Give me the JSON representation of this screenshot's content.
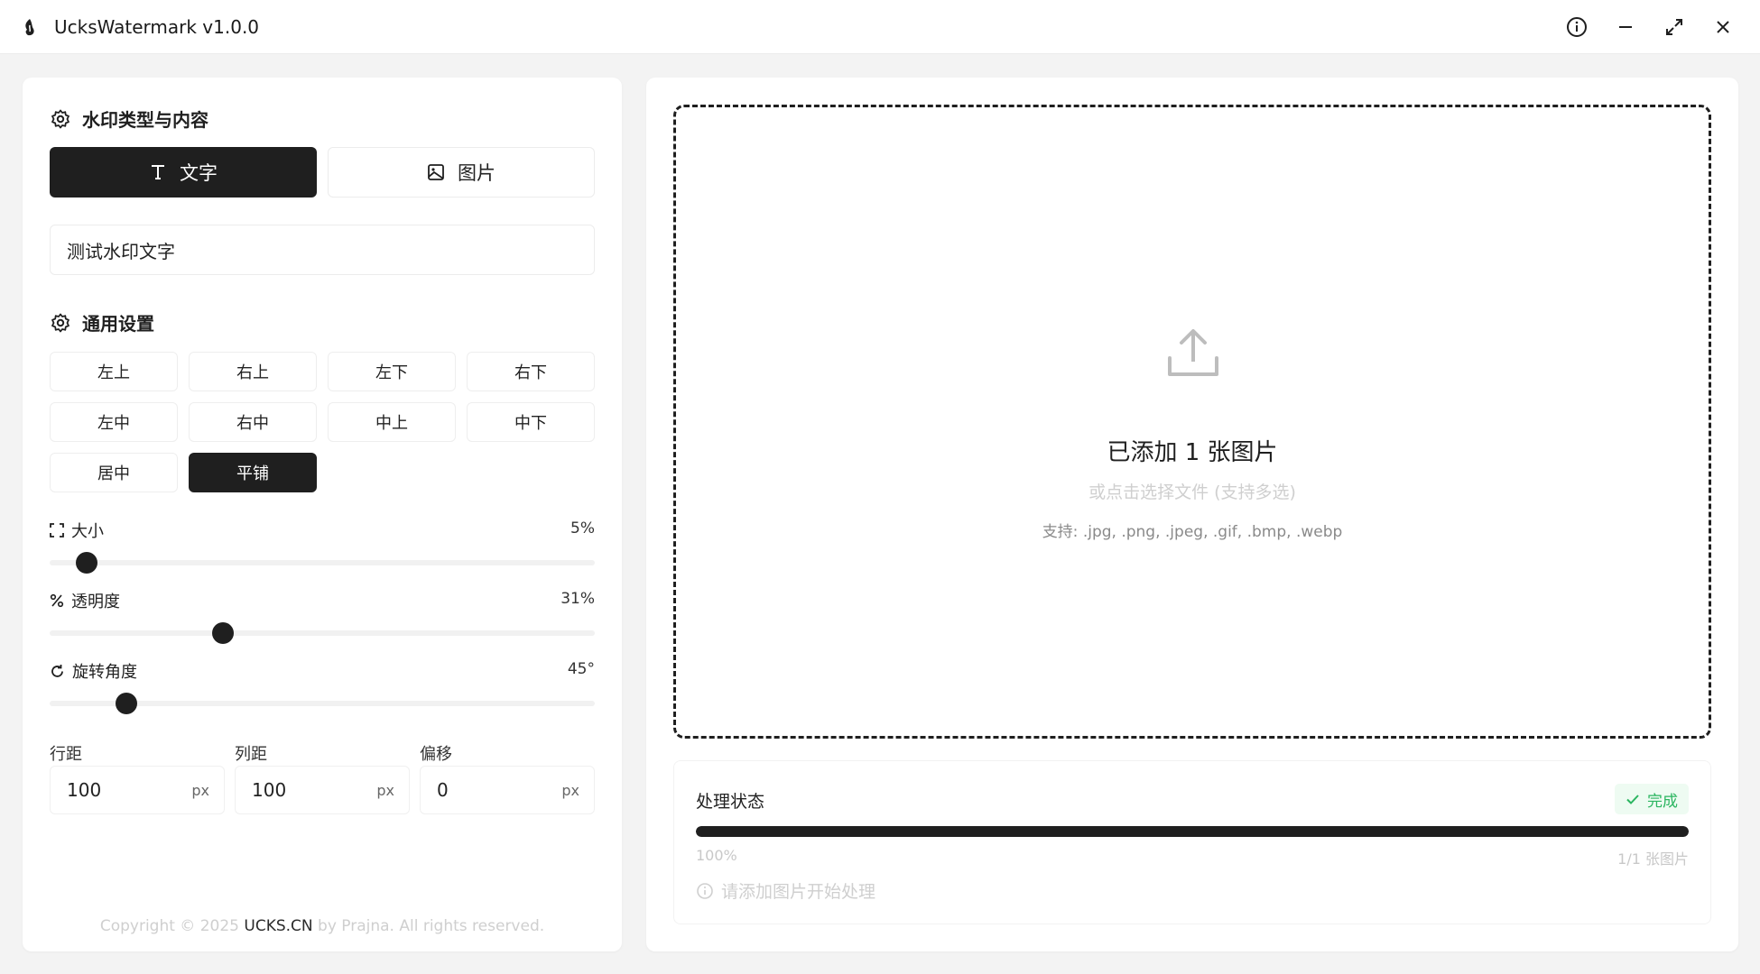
{
  "window": {
    "title": "UcksWatermark v1.0.0",
    "controls": [
      "info-icon",
      "minimize-icon",
      "maximize-icon",
      "close-icon"
    ]
  },
  "left": {
    "type_section_title": "水印类型与内容",
    "type_buttons": {
      "text": "文字",
      "image": "图片",
      "selected": "text"
    },
    "watermark_text": "测试水印文字",
    "general_section_title": "通用设置",
    "positions": [
      "左上",
      "右上",
      "左下",
      "右下",
      "左中",
      "右中",
      "中上",
      "中下",
      "居中",
      "平铺"
    ],
    "selected_position": "平铺",
    "sliders": {
      "size": {
        "label": "大小",
        "value_text": "5%",
        "value": 5,
        "min": 0,
        "max": 100
      },
      "opacity": {
        "label": "透明度",
        "value_text": "31%",
        "value": 31,
        "min": 0,
        "max": 100
      },
      "rotation": {
        "label": "旋转角度",
        "value_text": "45°",
        "value": 45,
        "min": 0,
        "max": 360
      }
    },
    "spacing": {
      "row": {
        "label": "行距",
        "value": "100",
        "unit": "px"
      },
      "col": {
        "label": "列距",
        "value": "100",
        "unit": "px"
      },
      "offset": {
        "label": "偏移",
        "value": "0",
        "unit": "px"
      }
    },
    "copyright": {
      "prefix": "Copyright © 2025 ",
      "brand": "UCKS.CN",
      "suffix": " by Prajna. All rights reserved."
    }
  },
  "right": {
    "drop_title": "已添加 1 张图片",
    "drop_subtitle": "或点击选择文件 (支持多选)",
    "drop_support": "支持: .jpg, .png, .jpeg, .gif, .bmp, .webp",
    "status": {
      "title": "处理状态",
      "badge": "完成",
      "progress": 1.0,
      "progress_text": "100%",
      "count_text": "1/1 张图片",
      "hint": "请添加图片开始处理"
    }
  },
  "colors": {
    "primary": "#1f1f1f",
    "success": "#2bb560",
    "muted": "#cfcfcf"
  }
}
